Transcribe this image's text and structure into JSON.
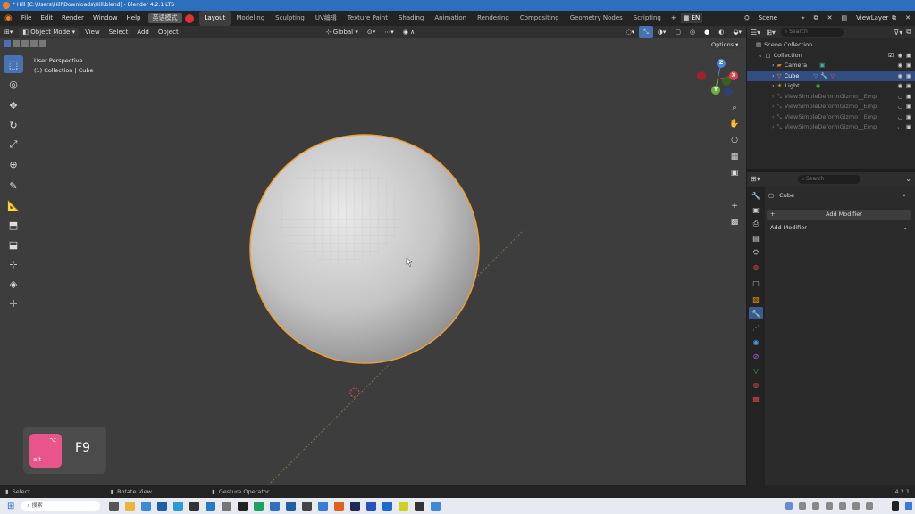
{
  "window": {
    "title": "* Hill [C:\\Users\\Hill\\Downloads\\Hill.blend] - Blender 4.2.1 LTS"
  },
  "menu": {
    "file": "File",
    "edit": "Edit",
    "render": "Render",
    "window": "Window",
    "help": "Help",
    "ime": "英语模式"
  },
  "workspaces": [
    "Layout",
    "Modeling",
    "Sculpting",
    "UV编辑",
    "Texture Paint",
    "Shading",
    "Animation",
    "Rendering",
    "Compositing",
    "Geometry Nodes",
    "Scripting"
  ],
  "lang": "EN",
  "scene": {
    "name": "Scene",
    "view_layer": "ViewLayer"
  },
  "viewport_header": {
    "mode": "Object Mode",
    "view": "View",
    "select": "Select",
    "add": "Add",
    "object": "Object",
    "orientation": "Global",
    "options": "Options"
  },
  "viewport": {
    "perspective": "User Perspective",
    "collection_info": "(1) Collection | Cube"
  },
  "gizmo": {
    "x": "X",
    "y": "Y",
    "z": "Z"
  },
  "outliner": {
    "search_placeholder": "Search",
    "scene_collection": "Scene Collection",
    "collection": "Collection",
    "items": [
      {
        "name": "Camera",
        "selected": false
      },
      {
        "name": "Cube",
        "selected": true
      },
      {
        "name": "Light",
        "selected": false
      },
      {
        "name": "ViewSimpleDeformGizmo__Emp",
        "selected": false
      },
      {
        "name": "ViewSimpleDeformGizmo__Emp",
        "selected": false
      },
      {
        "name": "ViewSimpleDeformGizmo__Emp",
        "selected": false
      },
      {
        "name": "ViewSimpleDeformGizmo__Emp",
        "selected": false
      }
    ]
  },
  "properties": {
    "search_placeholder": "Search",
    "object_name": "Cube",
    "add_modifier_button": "Add Modifier",
    "add_modifier_dropdown": "Add Modifier"
  },
  "keycast": {
    "modifier": "alt",
    "key": "F9"
  },
  "statusbar": {
    "select": "Select",
    "rotate": "Rotate View",
    "gesture": "Gesture Operator",
    "version": "4.2.1"
  },
  "taskbar": {
    "search_placeholder": "搜索"
  },
  "colors": {
    "accent": "#4772b3",
    "selection_outline": "#f0a030",
    "title_bar": "#2c6fbd",
    "keycap": "#e8558a"
  }
}
